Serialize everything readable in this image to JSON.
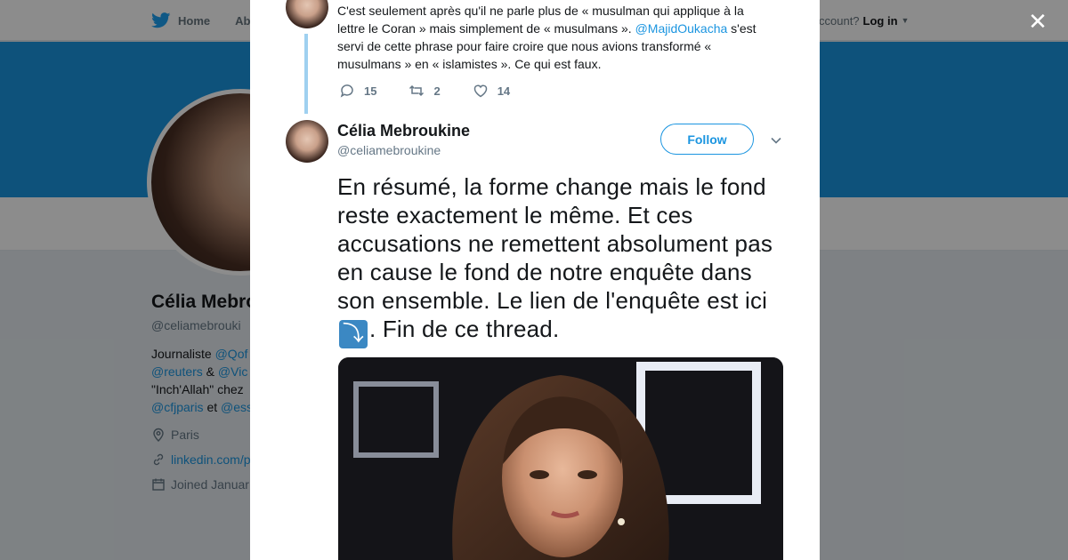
{
  "nav": {
    "home_label": "Home",
    "about_label": "Abo",
    "account_prompt": "ccount?",
    "login_label": "Log in"
  },
  "profile": {
    "name": "Célia Mebro",
    "handle": "@celiamebrouki",
    "bio_lines": [
      {
        "prefix": "Journaliste ",
        "link": "@Qof",
        "suffix": ""
      },
      {
        "prefix": "",
        "link": "@reuters",
        "suffix": " & ",
        "link2": "@Vic"
      },
      {
        "prefix": "\"Inch'Allah\" chez ",
        "link": "",
        "suffix": ""
      },
      {
        "prefix": "",
        "link": "@cfjparis",
        "suffix": " et ",
        "link2": "@ess"
      }
    ],
    "location": "Paris",
    "website": "linkedin.com/p",
    "joined": "Joined Januar"
  },
  "modal": {
    "previous_tweet": {
      "text_before": "C'est seulement après qu'il ne parle plus de « musulman qui applique à la lettre le Coran » mais simplement de « musulmans ». ",
      "mention": "@MajidOukacha",
      "text_after": " s'est servi de cette phrase pour faire croire que nous avions transformé « musulmans » en « islamistes ». Ce qui est faux.",
      "replies": "15",
      "retweets": "2",
      "likes": "14"
    },
    "tweet": {
      "author_name": "Célia Mebroukine",
      "author_handle": "@celiamebroukine",
      "follow_label": "Follow",
      "text_before_emoji": "En résumé, la forme change mais le fond reste exactement le même. Et ces accusations ne remettent absolument pas en cause le fond de notre enquête dans son ensemble. Le lien de l'enquête est ici ",
      "emoji": "⤵",
      "text_after_emoji": ". Fin de ce thread."
    }
  },
  "colors": {
    "accent": "#1b95e0",
    "banner": "#1b95e0",
    "thread_line": "#9fd0f0"
  }
}
